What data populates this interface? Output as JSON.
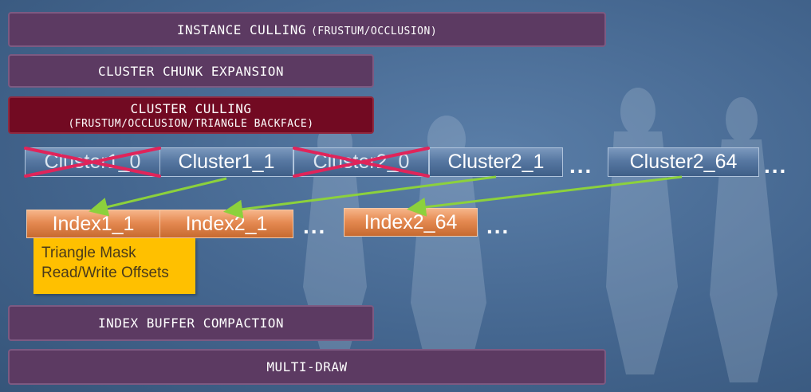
{
  "stages": {
    "instance_culling": {
      "label": "INSTANCE CULLING",
      "sub": "(FRUSTUM/OCCLUSION)"
    },
    "chunk_expansion": {
      "label": "CLUSTER CHUNK EXPANSION"
    },
    "cluster_culling": {
      "label": "CLUSTER CULLING",
      "sub": "(FRUSTUM/OCCLUSION/TRIANGLE BACKFACE)"
    },
    "index_compaction": {
      "label": "INDEX BUFFER COMPACTION"
    },
    "multi_draw": {
      "label": "MULTI-DRAW"
    }
  },
  "clusters": [
    {
      "label": "Cluster1_0",
      "culled": true
    },
    {
      "label": "Cluster1_1",
      "culled": false
    },
    {
      "label": "Cluster2_0",
      "culled": true
    },
    {
      "label": "Cluster2_1",
      "culled": false
    },
    {
      "label": "Cluster2_64",
      "culled": false
    }
  ],
  "indices": [
    "Index1_1",
    "Index2_1",
    "Index2_64"
  ],
  "ellipsis": "...",
  "note": {
    "line1": "Triangle Mask",
    "line2": "Read/Write Offsets"
  },
  "colors": {
    "stage": "#5c3a62",
    "stage_highlight": "#720a22",
    "cluster": "#5778a2",
    "index": "#e58a52",
    "note": "#ffc000",
    "arrow": "#8cd13c",
    "cross": "#e0245a"
  }
}
